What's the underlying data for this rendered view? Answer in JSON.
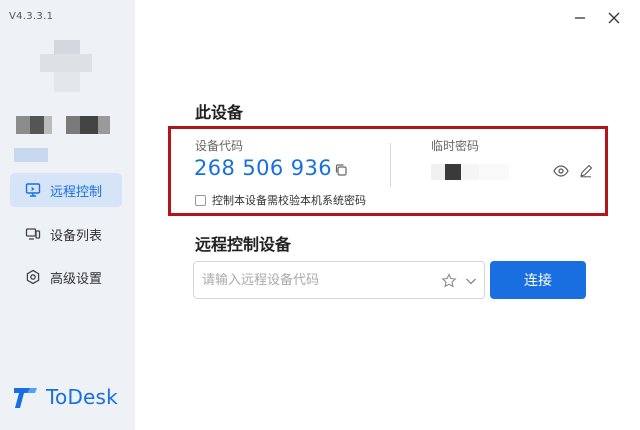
{
  "app": {
    "version": "V4.3.3.1",
    "brand": "ToDesk",
    "accent_color": "#1a6fe0",
    "highlight_color": "#b3141a"
  },
  "sidebar": {
    "items": [
      {
        "label": "远程控制",
        "icon": "monitor-icon",
        "active": true
      },
      {
        "label": "设备列表",
        "icon": "devices-icon",
        "active": false
      },
      {
        "label": "高级设置",
        "icon": "settings-icon",
        "active": false
      }
    ]
  },
  "this_device": {
    "title": "此设备",
    "device_code_label": "设备代码",
    "device_code": "268 506 936",
    "temp_password_label": "临时密码",
    "checkbox_label": "控制本设备需校验本机系统密码"
  },
  "remote": {
    "title": "远程控制设备",
    "placeholder": "请输入远程设备代码",
    "connect_label": "连接"
  }
}
